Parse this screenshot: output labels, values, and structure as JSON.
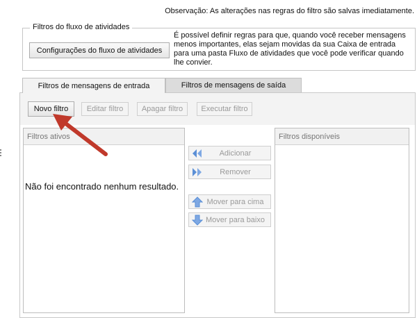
{
  "note": "Observação: As alterações nas regras do filtro são salvas imediatamente.",
  "clutter_group": {
    "legend": "Filtros do fluxo de atividades",
    "settings_button": "Configurações do fluxo de atividades",
    "description": "É possível definir regras para que, quando você receber mensagens menos importantes, elas sejam movidas da sua Caixa de entrada para uma pasta Fluxo de atividades que você pode verificar quando lhe convier."
  },
  "tabs": [
    {
      "label": "Filtros de mensagens de entrada",
      "active": true
    },
    {
      "label": "Filtros de mensagens de saída",
      "active": false
    }
  ],
  "toolbar": {
    "new_filter": "Novo filtro",
    "edit_filter": "Editar filtro",
    "delete_filter": "Apagar filtro",
    "run_filter": "Executar filtro"
  },
  "active_filters": {
    "header": "Filtros ativos",
    "empty_message": "Não foi encontrado nenhum resultado."
  },
  "available_filters": {
    "header": "Filtros disponíveis"
  },
  "actions": {
    "add": "Adicionar",
    "remove": "Remover",
    "move_up": "Mover para cima",
    "move_down": "Mover para baixo"
  },
  "colors": {
    "annotation_arrow": "#c0392b",
    "action_icon_blue": "#5b8fd6"
  }
}
